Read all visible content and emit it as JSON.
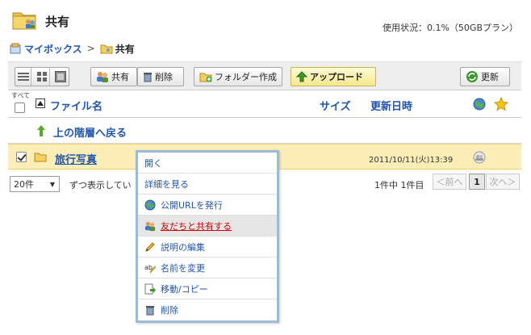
{
  "header": {
    "title": "共有",
    "usage": "使用状況：0.1%（50GBプラン）"
  },
  "breadcrumb": {
    "root": "マイボックス",
    "separator": ">",
    "current": "共有"
  },
  "toolbar": {
    "share_label": "共有",
    "delete_label": "削除",
    "new_folder_label": "フォルダー作成",
    "upload_label": "アップロード",
    "refresh_label": "更新"
  },
  "table": {
    "select_all_label": "すべて",
    "columns": {
      "name": "ファイル名",
      "size": "サイズ",
      "date": "更新日時"
    },
    "up_label": "上の階層へ戻る",
    "rows": [
      {
        "name": "旅行写真",
        "date": "2011/10/11(火)13:39",
        "selected": true
      }
    ]
  },
  "paging": {
    "per_page": "20件",
    "display_text": "ずつ表示してい",
    "count_text": "1件中 1件目",
    "prev": "＜前へ",
    "page": "1",
    "next": "次へ＞"
  },
  "context_menu": {
    "items": [
      {
        "label": "開く",
        "icon": ""
      },
      {
        "label": "詳細を見る",
        "icon": ""
      },
      {
        "label": "公開URLを発行",
        "icon": "globe-icon"
      },
      {
        "label": "友だちと共有する",
        "icon": "share-users-icon",
        "hover": true
      },
      {
        "label": "説明の編集",
        "icon": "pencil-icon"
      },
      {
        "label": "名前を変更",
        "icon": "rename-icon"
      },
      {
        "label": "移動/コピー",
        "icon": "move-copy-icon"
      },
      {
        "label": "削除",
        "icon": "trash-icon"
      }
    ]
  },
  "colors": {
    "link": "#2255aa",
    "selected_row": "#fdeeb8",
    "menu_border": "#9dbbd6",
    "hover_text": "#cc0000"
  }
}
